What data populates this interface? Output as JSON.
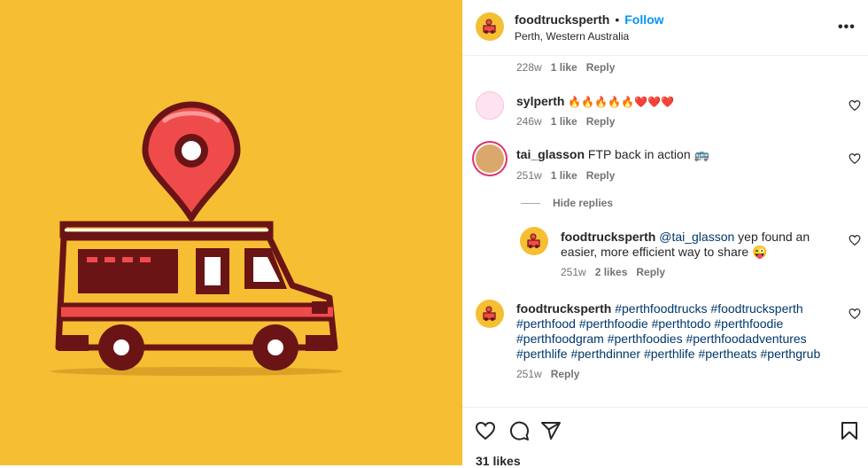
{
  "post": {
    "author": "foodtrucksperth",
    "follow_label": "Follow",
    "separator": "•",
    "location": "Perth, Western Australia",
    "more_label": "•••"
  },
  "comments": [
    {
      "meta_time": "228w",
      "meta_likes": "1 like",
      "reply": "Reply"
    },
    {
      "user": "sylperth",
      "text": "🔥🔥🔥🔥🔥❤️❤️❤️",
      "meta_time": "246w",
      "meta_likes": "1 like",
      "reply": "Reply"
    },
    {
      "user": "tai_glasson",
      "text": "FTP back in action 🚌",
      "meta_time": "251w",
      "meta_likes": "1 like",
      "reply": "Reply"
    }
  ],
  "hide_replies": "Hide replies",
  "reply_comment": {
    "user": "foodtrucksperth",
    "mention": "@tai_glasson",
    "text": "yep found an easier, more efficient way to share 😜",
    "meta_time": "251w",
    "meta_likes": "2 likes",
    "reply": "Reply"
  },
  "caption": {
    "user": "foodtrucksperth",
    "tags": [
      "#perthfoodtrucks",
      "#foodtrucksperth",
      "#perthfood",
      "#perthfoodie",
      "#perthtodo",
      "#perthfoodie",
      "#perthfoodgram",
      "#perthfoodies",
      "#perthfoodadventures",
      "#perthlife",
      "#perthdinner",
      "#perthlife",
      "#pertheats",
      "#perthgrub"
    ],
    "tag_lines": [
      "#perthfoodtrucks #foodtrucksperth",
      "#perthfood #perthfoodie #perthtodo #perthfoodie",
      "#perthfoodgram #perthfoodies #perthfoodadventures",
      "#perthlife #perthdinner #perthlife #pertheats #perthgrub"
    ],
    "meta_time": "251w",
    "reply": "Reply"
  },
  "footer": {
    "likes": "31 likes"
  },
  "colors": {
    "media_bg": "#f6be33",
    "truck_dark": "#6b1416",
    "truck_red": "#f04b4b",
    "accent": "#0095f6",
    "hashtag": "#00376b"
  },
  "icons": [
    "more-icon",
    "heart-icon",
    "comment-icon",
    "share-icon",
    "bookmark-icon",
    "location-pin-icon",
    "food-truck-icon"
  ]
}
